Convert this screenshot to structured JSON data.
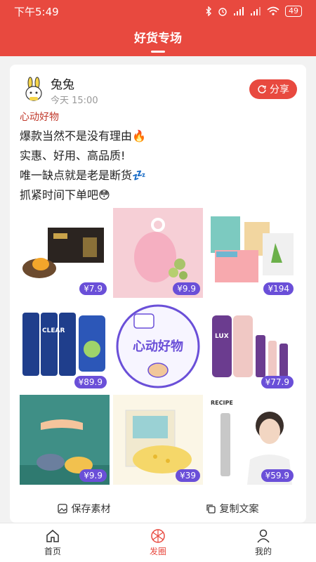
{
  "status_bar": {
    "time": "下午5:49",
    "battery": "49"
  },
  "nav": {
    "title": "好货专场"
  },
  "post": {
    "username": "兔兔",
    "time": "今天 15:00",
    "share_label": "分享",
    "tag": "心动好物",
    "lines": [
      "爆款当然不是没有理由🔥",
      "实惠、好用、高品质!",
      "唯一缺点就是老是断货💤",
      "抓紧时间下单吧😳"
    ],
    "products": [
      {
        "name": "蛋黄酥礼盒",
        "price": "¥7.9"
      },
      {
        "name": "粉色水杯",
        "price": "¥9.9"
      },
      {
        "name": "面膜",
        "price": "¥194"
      },
      {
        "name": "清扬洗发水",
        "price": "¥89.9"
      },
      {
        "name": "心动好物贴纸",
        "price": ""
      },
      {
        "name": "力士沐浴露",
        "price": "¥77.9"
      },
      {
        "name": "拖鞋",
        "price": "¥9.9"
      },
      {
        "name": "海绵",
        "price": "¥39"
      },
      {
        "name": "定型喷雾",
        "price": "¥59.9"
      }
    ],
    "sticker_text": "心动好物",
    "brand_clear": "CLEAR",
    "brand_lux": "LUX",
    "brand_recipe": "RECIPE"
  },
  "actions": {
    "save_label": "保存素材",
    "copy_label": "复制文案"
  },
  "tabbar": {
    "home": "首页",
    "moments": "发圈",
    "mine": "我的"
  },
  "colors": {
    "primary": "#e8493f",
    "price_bg": "#6a4fd8"
  }
}
